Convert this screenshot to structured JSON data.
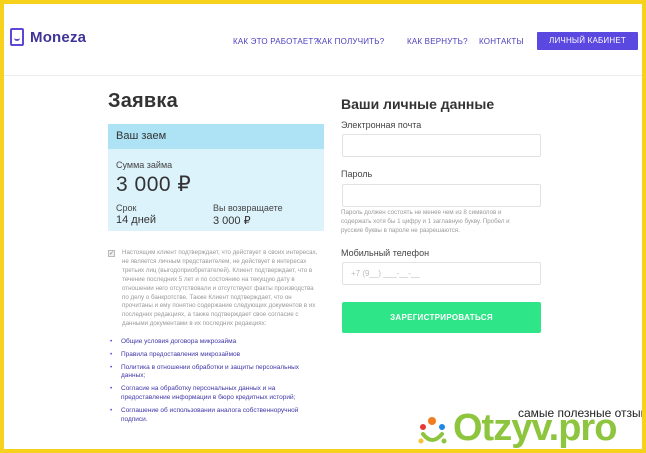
{
  "brand": {
    "name": "Moneza",
    "accent": "#5b48e0",
    "frame": "#f6d21c"
  },
  "nav": {
    "items": [
      "КАК ЭТО РАБОТАЕТ?",
      "КАК ПОЛУЧИТЬ?",
      "КАК ВЕРНУТЬ?",
      "КОНТАКТЫ"
    ],
    "cabinet_label": "ЛИЧНЫЙ КАБИНЕТ"
  },
  "application": {
    "title": "Заявка",
    "loan": {
      "header": "Ваш заем",
      "amount_label": "Сумма займа",
      "amount": "3 000 ₽",
      "term_label": "Срок",
      "term": "14 дней",
      "return_label": "Вы возвращаете",
      "return_amount": "3 000 ₽"
    },
    "consent_checked": true,
    "consent_text": "Настоящим клиент подтверждает, что действует в своих интересах, не является личным представителем, не действует в интересах третьих лиц (выгодоприобретателей). Клиент подтверждает, что в течение последних 5 лет и по состоянию на текущую дату в отношении него отсутствовали и отсутствуют факты производства по делу о банкротстве. Также Клиент подтверждает, что он прочитаны и ему понятно содержание следующих документов в их последних редакциях, а также подтверждает свое согласие с данными документами в их последних редакциях:",
    "documents": [
      "Общие условия договора микрозайма",
      "Правила предоставления микрозаймов",
      "Политика в отношении обработки и защиты персональных данных;",
      "Согласие на обработку персональных данных и на предоставление информации в бюро кредитных историй;",
      "Соглашение об использовании аналога собственноручной подписи."
    ]
  },
  "form": {
    "title": "Ваши личные данные",
    "email_label": "Электронная почта",
    "email_value": "",
    "password_label": "Пароль",
    "password_value": "",
    "password_hint": "Пароль должен состоять не менее чем из 8 символов и содержать хотя бы 1 цифру и 1 заглавную букву. Пробел и русские буквы в пароле не разрешаются.",
    "phone_label": "Мобильный телефон",
    "phone_placeholder": "+7 (9__) ___-__-__",
    "submit_label": "ЗАРЕГИСТРИРОВАТЬСЯ",
    "submit_color": "#2ee587"
  },
  "watermark": {
    "caption": "самые полезные отзывы",
    "text": "Otzyv.pro",
    "color": "#8ec53f"
  }
}
